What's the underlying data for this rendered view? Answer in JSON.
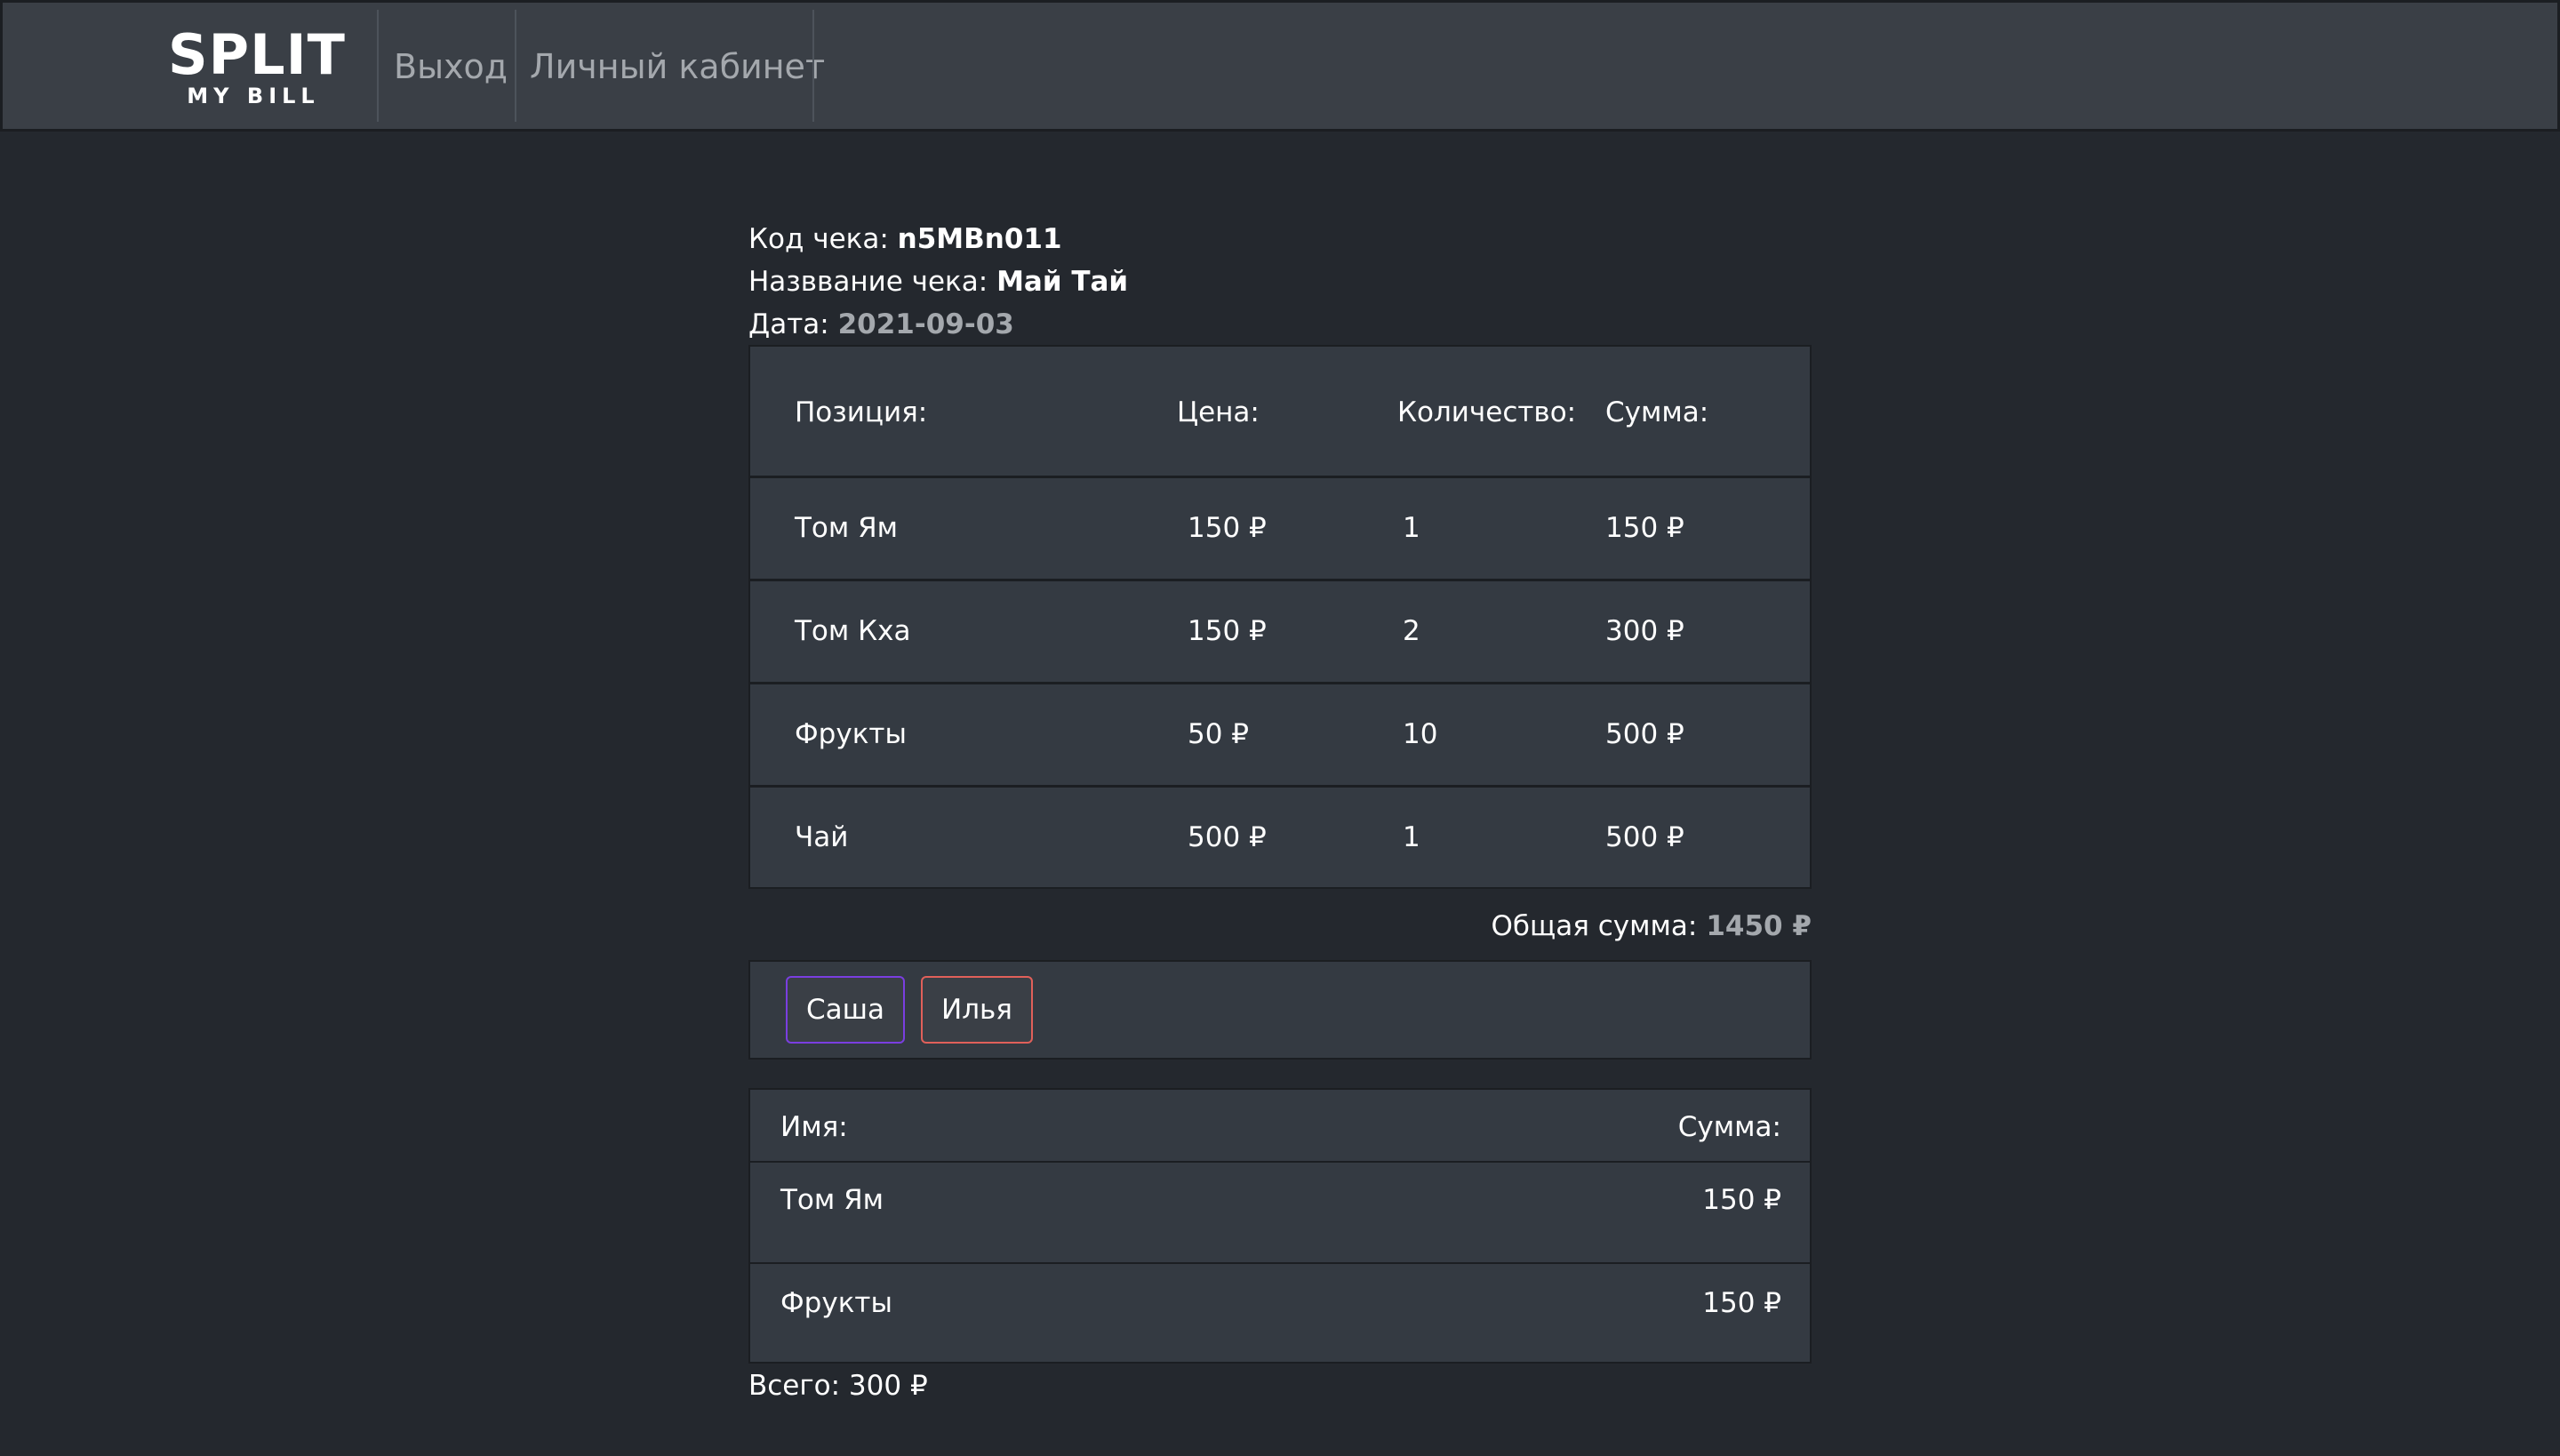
{
  "nav": {
    "logo_main": "SPLIT",
    "logo_sub": "MY BILL",
    "logout": "Выход",
    "cabinet": "Личный кабинет"
  },
  "receipt": {
    "code_label": "Код чека: ",
    "code": "n5MBn011",
    "name_label": "Назввание чека: ",
    "name": "Май Тай",
    "date_label": "Дата: ",
    "date": "2021-09-03"
  },
  "items_table": {
    "headers": [
      "Позиция:",
      "Цена:",
      "Количество:",
      "Сумма:"
    ],
    "rows": [
      [
        "Том Ям",
        "150 ₽",
        "1",
        "150 ₽"
      ],
      [
        "Том Кха",
        "150 ₽",
        "2",
        "300 ₽"
      ],
      [
        "Фрукты",
        "50 ₽",
        "10",
        "500 ₽"
      ],
      [
        "Чай",
        "500 ₽",
        "1",
        "500 ₽"
      ]
    ]
  },
  "total": {
    "label": "Общая сумма:",
    "value": "1450 ₽"
  },
  "people": [
    {
      "name": "Саша",
      "color": "#7a3ee0"
    },
    {
      "name": "Илья",
      "color": "#e0605a"
    }
  ],
  "split_table": {
    "headers": [
      "Имя:",
      "Сумма:"
    ],
    "rows": [
      [
        "Том Ям",
        "150 ₽"
      ],
      [
        "Фрукты",
        "150 ₽"
      ]
    ]
  },
  "grand_total": "Всего: 300 ₽",
  "colors": {
    "background": "#24282e",
    "navbar": "#3a3f46",
    "panel": "#343a42",
    "muted_text": "#a4a8ad"
  }
}
